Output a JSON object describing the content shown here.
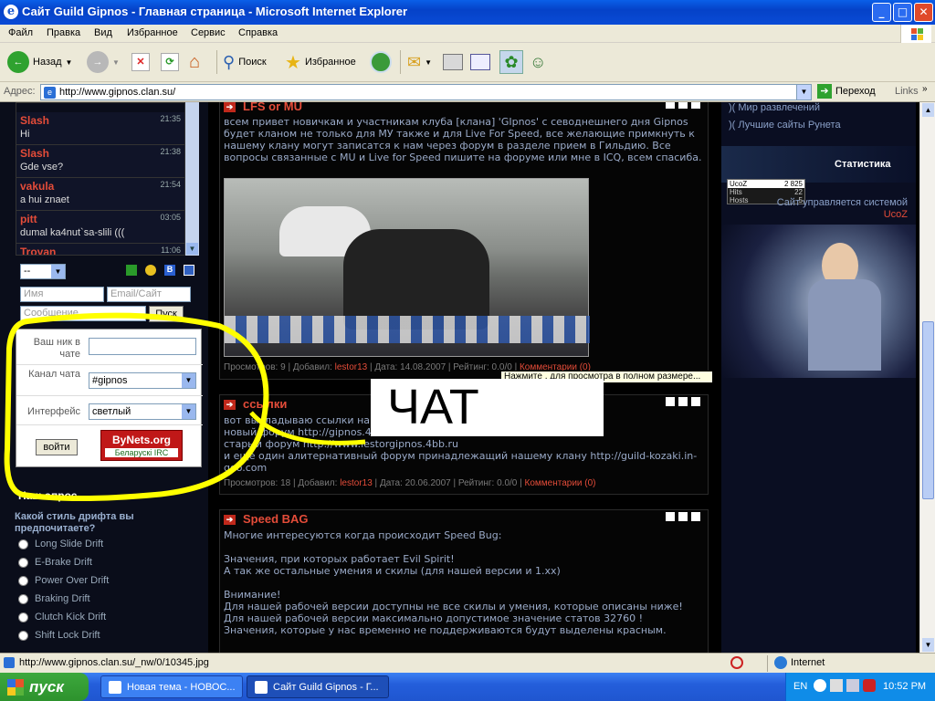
{
  "window": {
    "title": "Сайт Guild Gipnos - Главная страница - Microsoft Internet Explorer",
    "min": "_",
    "max": "□",
    "close": "✕"
  },
  "menu": [
    "Файл",
    "Правка",
    "Вид",
    "Избранное",
    "Сервис",
    "Справка"
  ],
  "toolbar": {
    "back": "Назад",
    "search": "Поиск",
    "favorites": "Избранное"
  },
  "address": {
    "label": "Адрес:",
    "url": "http://www.gipnos.clan.su/",
    "go": "Переход",
    "links": "Links"
  },
  "chat": {
    "messages": [
      {
        "name": "Slash",
        "time": "21:35",
        "text": "Hi"
      },
      {
        "name": "Slash",
        "time": "21:38",
        "text": "Gde vse?"
      },
      {
        "name": "vakula",
        "time": "21:54",
        "text": "a hui znaet"
      },
      {
        "name": "pitt",
        "time": "03:05",
        "text": "dumal ka4nut`sa-slili ((("
      },
      {
        "name": "Troyan",
        "time": "11:06",
        "text": ""
      }
    ],
    "select": "--",
    "name_placeholder": "Имя",
    "email_placeholder": "Email/Сайт",
    "message_placeholder": "Сообщение",
    "send": "Пуск",
    "nick_label": "Ваш ник в чате",
    "channel_label": "Канал чата",
    "channel_value": "#gipnos",
    "ui_label": "Интерфейс",
    "ui_value": "светлый",
    "login": "войти",
    "banner_top": "ByNets.org",
    "banner_bottom": "Беларускі IRC"
  },
  "overlay_text": "ЧАТ",
  "poll": {
    "heading": "Наш опрос",
    "question": "Какой стиль дрифта вы предпочитаете?",
    "options": [
      "Long Slide Drift",
      "E-Brake Drift",
      "Power Over Drift",
      "Braking Drift",
      "Clutch Kick Drift",
      "Shift Lock Drift"
    ]
  },
  "posts": [
    {
      "title": "LFS or MU",
      "body": "всем привет новичкам и участникам клуба [клана] 'GIpnos' с севоднешнего дня Gipnos будет кланом не только для МУ также и для Live For Speed, все желающие примкнуть к нашему клану могут записатся к нам через форум в разделе прием в Гильдию. Все вопросы связанные с MU и Live for Speed пишите на форуме или мне в ICQ, всем спасиба.",
      "views": "Просмотров: 9",
      "added": "Добавил:",
      "author": "lestor13",
      "date": "Дата: 14.08.2007",
      "rating": "Рейтинг: 0.0/0",
      "comments": "Комментарии (0)",
      "tooltip": "Нажмите , для просмотра в полном размере..."
    },
    {
      "title": "ссылки",
      "body": "вот выкладываю ссылки на наши форумы чтобы потом не искать -)\nновый форум http://gipnos.4bb.ru\nстарый форум http://www.lestorgipnos.4bb.ru\nи еще один алитернативный форум принадлежащий нашему клану http://guild-kozaki.in-goo.com",
      "views": "Просмотров: 18",
      "added": "Добавил:",
      "author": "lestor13",
      "date": "Дата: 20.06.2007",
      "rating": "Рейтинг: 0.0/0",
      "comments": "Комментарии (0)"
    },
    {
      "title": "Speed BAG",
      "body": "Многие интересуются когда происходит Speed Bug:\n\nЗначения, при которых работает Evil Spirit!\nА так же остальные умения и скилы (для нашей версии и 1.xx)\n\nВнимание!\nДля нашей рабочей версии доступны не все скилы и умения, которые описаны ниже!\nДля нашей рабочей версии максимально допустимое значение статов 32760 !\nЗначения, которые у нас временно не поддерживаются будут выделены красным."
    }
  ],
  "right": {
    "links": [
      "Мир развлечений",
      "Лучшие сайты Рунета"
    ],
    "stats_title": "Статистика",
    "counter": {
      "brand": "UcoZ",
      "total": "2 825",
      "hits_label": "Hits",
      "hits": "22",
      "hosts_label": "Hosts",
      "hosts": "5"
    },
    "powered": "Сайт управляется системой",
    "powered_brand": "UcoZ"
  },
  "status": {
    "url": "http://www.gipnos.clan.su/_nw/0/10345.jpg",
    "zone": "Internet"
  },
  "taskbar": {
    "start": "пуск",
    "tasks": [
      "Новая тема - НОВОС...",
      "Сайт Guild Gipnos - Г..."
    ],
    "lang": "EN",
    "clock": "10:52 PM"
  },
  "colors": {
    "accent_red": "#e44c39",
    "highlight_yellow": "#ffff00",
    "xp_blue": "#245edb"
  }
}
